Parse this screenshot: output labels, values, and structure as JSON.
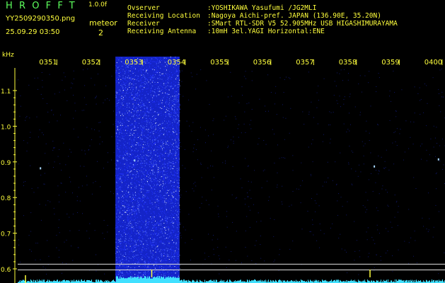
{
  "header": {
    "app_title": "HROFFT",
    "version": "1.0.0f",
    "filename": "YY2509290350.png",
    "datetime": "25.09.29 03:50",
    "detect_type": "meteor",
    "detect_count": "2"
  },
  "station": [
    {
      "key": "Ovserver",
      "value": ":YOSHIKAWA Yasufumi /JG2MLI"
    },
    {
      "key": "Receiving Location",
      "value": ":Nagoya Aichi-pref. JAPAN (136.90E, 35.20N)"
    },
    {
      "key": "Receiver",
      "value": ":SMart RTL-SDR V5 52.905MHz USB HIGASHIMURAYAMA"
    },
    {
      "key": "Receiving Antenna",
      "value": ":10mH 3el.YAGI Horizontal:ENE"
    }
  ],
  "colors": {
    "label_green": "#5dff5d",
    "label_yellow": "#ffff3c",
    "background": "#000000",
    "noise_blue": "#2233ff",
    "reference_line": "#e0e0e0",
    "baseline_cyan": "#40e0ff"
  },
  "chart_data": {
    "type": "heatmap",
    "title": "",
    "xlabel": "",
    "ylabel": "kHz",
    "x_ticks": [
      "0351",
      "0352",
      "0353",
      "0354",
      "0355",
      "0356",
      "0357",
      "0358",
      "0359",
      "0400"
    ],
    "y_ticks": [
      "1.1",
      "1.0",
      "0.9",
      "0.8",
      "0.7",
      "0.6"
    ],
    "ylim": [
      0.58,
      1.18
    ],
    "xlim_minutes": [
      0,
      10
    ],
    "reference_lines_khz": [
      0.613,
      0.597
    ],
    "noise_burst": {
      "start_min": 2.15,
      "end_min": 3.65
    },
    "echo_points": [
      {
        "t": 0.4,
        "f": 0.883
      },
      {
        "t": 2.6,
        "f": 0.905
      },
      {
        "t": 8.2,
        "f": 0.888
      },
      {
        "t": 9.7,
        "f": 0.908
      }
    ],
    "detections": [
      3.0,
      8.1
    ],
    "grid": false
  }
}
